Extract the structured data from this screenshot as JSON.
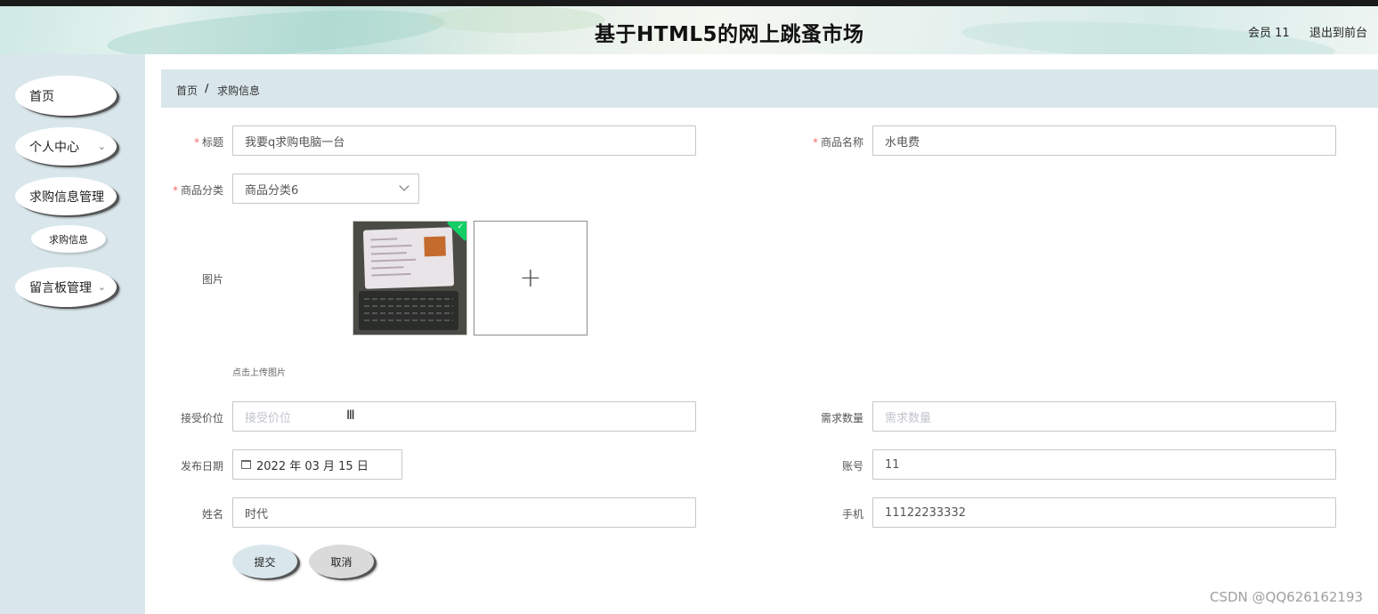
{
  "header": {
    "title": "基于HTML5的网上跳蚤市场",
    "user": "会员 11",
    "logout": "退出到前台"
  },
  "sidebar": {
    "items": [
      {
        "label": "首页",
        "chevron": false
      },
      {
        "label": "个人中心",
        "chevron": true
      },
      {
        "label": "求购信息管理",
        "chevron": false
      },
      {
        "label": "求购信息",
        "sub": true
      },
      {
        "label": "留言板管理",
        "chevron": true
      }
    ]
  },
  "breadcrumb": {
    "home": "首页",
    "separator": "/",
    "current": "求购信息"
  },
  "form": {
    "title_label": "标题",
    "title_value": "我要q求购电脑一台",
    "product_name_label": "商品名称",
    "product_name_value": "水电费",
    "category_label": "商品分类",
    "category_value": "商品分类6",
    "image_label": "图片",
    "upload_tip": "点击上传图片",
    "price_label": "接受价位",
    "price_placeholder": "接受价位",
    "quantity_label": "需求数量",
    "quantity_placeholder": "需求数量",
    "date_label": "发布日期",
    "date_value": "2022 年 03 月 15 日",
    "account_label": "账号",
    "account_value": "11",
    "name_label": "姓名",
    "name_value": "时代",
    "phone_label": "手机",
    "phone_value": "11122233332",
    "required_mark": "*"
  },
  "buttons": {
    "submit": "提交",
    "cancel": "取消"
  },
  "watermark": "CSDN @QQ626162193",
  "colors": {
    "sidebar_bg": "#d9e7ec",
    "required": "#f56c6c",
    "upload_success": "#13ce66"
  }
}
